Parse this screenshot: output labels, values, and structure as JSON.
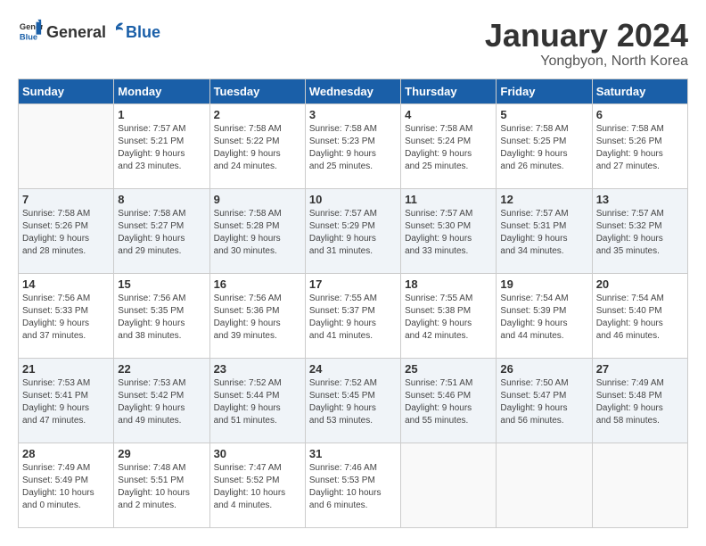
{
  "header": {
    "logo_general": "General",
    "logo_blue": "Blue",
    "month": "January 2024",
    "location": "Yongbyon, North Korea"
  },
  "days_of_week": [
    "Sunday",
    "Monday",
    "Tuesday",
    "Wednesday",
    "Thursday",
    "Friday",
    "Saturday"
  ],
  "weeks": [
    [
      {
        "day": "",
        "info": ""
      },
      {
        "day": "1",
        "info": "Sunrise: 7:57 AM\nSunset: 5:21 PM\nDaylight: 9 hours\nand 23 minutes."
      },
      {
        "day": "2",
        "info": "Sunrise: 7:58 AM\nSunset: 5:22 PM\nDaylight: 9 hours\nand 24 minutes."
      },
      {
        "day": "3",
        "info": "Sunrise: 7:58 AM\nSunset: 5:23 PM\nDaylight: 9 hours\nand 25 minutes."
      },
      {
        "day": "4",
        "info": "Sunrise: 7:58 AM\nSunset: 5:24 PM\nDaylight: 9 hours\nand 25 minutes."
      },
      {
        "day": "5",
        "info": "Sunrise: 7:58 AM\nSunset: 5:25 PM\nDaylight: 9 hours\nand 26 minutes."
      },
      {
        "day": "6",
        "info": "Sunrise: 7:58 AM\nSunset: 5:26 PM\nDaylight: 9 hours\nand 27 minutes."
      }
    ],
    [
      {
        "day": "7",
        "info": "Sunrise: 7:58 AM\nSunset: 5:26 PM\nDaylight: 9 hours\nand 28 minutes."
      },
      {
        "day": "8",
        "info": "Sunrise: 7:58 AM\nSunset: 5:27 PM\nDaylight: 9 hours\nand 29 minutes."
      },
      {
        "day": "9",
        "info": "Sunrise: 7:58 AM\nSunset: 5:28 PM\nDaylight: 9 hours\nand 30 minutes."
      },
      {
        "day": "10",
        "info": "Sunrise: 7:57 AM\nSunset: 5:29 PM\nDaylight: 9 hours\nand 31 minutes."
      },
      {
        "day": "11",
        "info": "Sunrise: 7:57 AM\nSunset: 5:30 PM\nDaylight: 9 hours\nand 33 minutes."
      },
      {
        "day": "12",
        "info": "Sunrise: 7:57 AM\nSunset: 5:31 PM\nDaylight: 9 hours\nand 34 minutes."
      },
      {
        "day": "13",
        "info": "Sunrise: 7:57 AM\nSunset: 5:32 PM\nDaylight: 9 hours\nand 35 minutes."
      }
    ],
    [
      {
        "day": "14",
        "info": "Sunrise: 7:56 AM\nSunset: 5:33 PM\nDaylight: 9 hours\nand 37 minutes."
      },
      {
        "day": "15",
        "info": "Sunrise: 7:56 AM\nSunset: 5:35 PM\nDaylight: 9 hours\nand 38 minutes."
      },
      {
        "day": "16",
        "info": "Sunrise: 7:56 AM\nSunset: 5:36 PM\nDaylight: 9 hours\nand 39 minutes."
      },
      {
        "day": "17",
        "info": "Sunrise: 7:55 AM\nSunset: 5:37 PM\nDaylight: 9 hours\nand 41 minutes."
      },
      {
        "day": "18",
        "info": "Sunrise: 7:55 AM\nSunset: 5:38 PM\nDaylight: 9 hours\nand 42 minutes."
      },
      {
        "day": "19",
        "info": "Sunrise: 7:54 AM\nSunset: 5:39 PM\nDaylight: 9 hours\nand 44 minutes."
      },
      {
        "day": "20",
        "info": "Sunrise: 7:54 AM\nSunset: 5:40 PM\nDaylight: 9 hours\nand 46 minutes."
      }
    ],
    [
      {
        "day": "21",
        "info": "Sunrise: 7:53 AM\nSunset: 5:41 PM\nDaylight: 9 hours\nand 47 minutes."
      },
      {
        "day": "22",
        "info": "Sunrise: 7:53 AM\nSunset: 5:42 PM\nDaylight: 9 hours\nand 49 minutes."
      },
      {
        "day": "23",
        "info": "Sunrise: 7:52 AM\nSunset: 5:44 PM\nDaylight: 9 hours\nand 51 minutes."
      },
      {
        "day": "24",
        "info": "Sunrise: 7:52 AM\nSunset: 5:45 PM\nDaylight: 9 hours\nand 53 minutes."
      },
      {
        "day": "25",
        "info": "Sunrise: 7:51 AM\nSunset: 5:46 PM\nDaylight: 9 hours\nand 55 minutes."
      },
      {
        "day": "26",
        "info": "Sunrise: 7:50 AM\nSunset: 5:47 PM\nDaylight: 9 hours\nand 56 minutes."
      },
      {
        "day": "27",
        "info": "Sunrise: 7:49 AM\nSunset: 5:48 PM\nDaylight: 9 hours\nand 58 minutes."
      }
    ],
    [
      {
        "day": "28",
        "info": "Sunrise: 7:49 AM\nSunset: 5:49 PM\nDaylight: 10 hours\nand 0 minutes."
      },
      {
        "day": "29",
        "info": "Sunrise: 7:48 AM\nSunset: 5:51 PM\nDaylight: 10 hours\nand 2 minutes."
      },
      {
        "day": "30",
        "info": "Sunrise: 7:47 AM\nSunset: 5:52 PM\nDaylight: 10 hours\nand 4 minutes."
      },
      {
        "day": "31",
        "info": "Sunrise: 7:46 AM\nSunset: 5:53 PM\nDaylight: 10 hours\nand 6 minutes."
      },
      {
        "day": "",
        "info": ""
      },
      {
        "day": "",
        "info": ""
      },
      {
        "day": "",
        "info": ""
      }
    ]
  ]
}
